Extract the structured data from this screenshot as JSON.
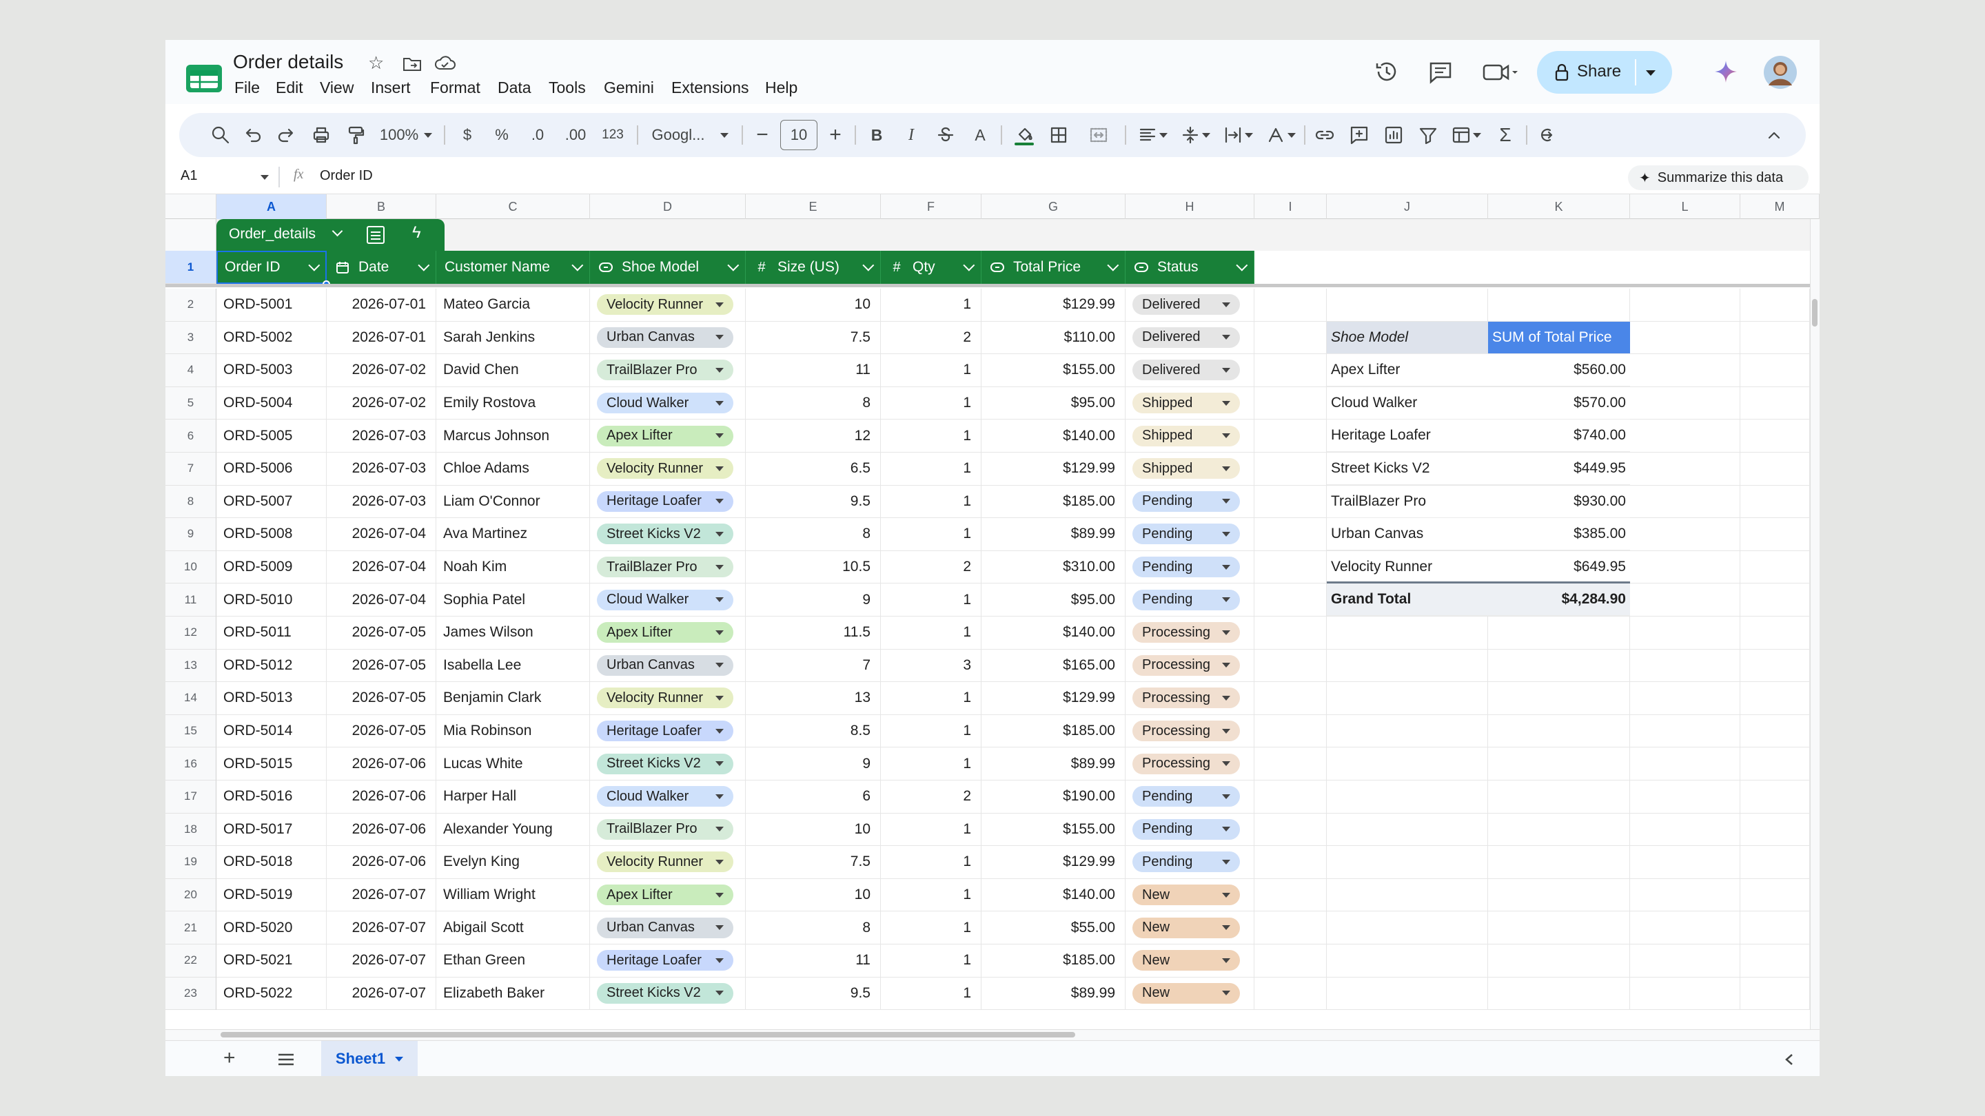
{
  "doc": {
    "title": "Order details"
  },
  "menu": [
    "File",
    "Edit",
    "View",
    "Insert",
    "Format",
    "Data",
    "Tools",
    "Gemini",
    "Extensions",
    "Help"
  ],
  "header": {
    "share_label": "Share"
  },
  "toolbar": {
    "zoom": "100%",
    "currency": "$",
    "percent": "%",
    "dec_less": ".0",
    "dec_more": ".00",
    "format_123": "123",
    "font": "Googl...",
    "font_size": "10",
    "bold": "B",
    "italic": "I",
    "text_color": "A"
  },
  "formula": {
    "cell_ref": "A1",
    "fx": "fx",
    "value": "Order ID",
    "summarize": "Summarize this data"
  },
  "columns": [
    "A",
    "B",
    "C",
    "D",
    "E",
    "F",
    "G",
    "H",
    "I",
    "J",
    "K",
    "L",
    "M"
  ],
  "table": {
    "name": "Order_details",
    "headers": [
      "Order ID",
      "Date",
      "Customer Name",
      "Shoe Model",
      "Size (US)",
      "Qty",
      "Total Price",
      "Status"
    ],
    "header_icons": {
      "date": "📅",
      "model": "⊙",
      "size": "#",
      "qty": "#",
      "price": "⊙",
      "status": "⊙"
    },
    "rows": [
      {
        "n": "2",
        "id": "ORD-5001",
        "date": "2026-07-01",
        "name": "Mateo Garcia",
        "model": "Velocity Runner",
        "size": "10",
        "qty": "1",
        "price": "$129.99",
        "status": "Delivered"
      },
      {
        "n": "3",
        "id": "ORD-5002",
        "date": "2026-07-01",
        "name": "Sarah Jenkins",
        "model": "Urban Canvas",
        "size": "7.5",
        "qty": "2",
        "price": "$110.00",
        "status": "Delivered"
      },
      {
        "n": "4",
        "id": "ORD-5003",
        "date": "2026-07-02",
        "name": "David Chen",
        "model": "TrailBlazer Pro",
        "size": "11",
        "qty": "1",
        "price": "$155.00",
        "status": "Delivered"
      },
      {
        "n": "5",
        "id": "ORD-5004",
        "date": "2026-07-02",
        "name": "Emily Rostova",
        "model": "Cloud Walker",
        "size": "8",
        "qty": "1",
        "price": "$95.00",
        "status": "Shipped"
      },
      {
        "n": "6",
        "id": "ORD-5005",
        "date": "2026-07-03",
        "name": "Marcus Johnson",
        "model": "Apex Lifter",
        "size": "12",
        "qty": "1",
        "price": "$140.00",
        "status": "Shipped"
      },
      {
        "n": "7",
        "id": "ORD-5006",
        "date": "2026-07-03",
        "name": "Chloe Adams",
        "model": "Velocity Runner",
        "size": "6.5",
        "qty": "1",
        "price": "$129.99",
        "status": "Shipped"
      },
      {
        "n": "8",
        "id": "ORD-5007",
        "date": "2026-07-03",
        "name": "Liam O'Connor",
        "model": "Heritage Loafer",
        "size": "9.5",
        "qty": "1",
        "price": "$185.00",
        "status": "Pending"
      },
      {
        "n": "9",
        "id": "ORD-5008",
        "date": "2026-07-04",
        "name": "Ava Martinez",
        "model": "Street Kicks V2",
        "size": "8",
        "qty": "1",
        "price": "$89.99",
        "status": "Pending"
      },
      {
        "n": "10",
        "id": "ORD-5009",
        "date": "2026-07-04",
        "name": "Noah Kim",
        "model": "TrailBlazer Pro",
        "size": "10.5",
        "qty": "2",
        "price": "$310.00",
        "status": "Pending"
      },
      {
        "n": "11",
        "id": "ORD-5010",
        "date": "2026-07-04",
        "name": "Sophia Patel",
        "model": "Cloud Walker",
        "size": "9",
        "qty": "1",
        "price": "$95.00",
        "status": "Pending"
      },
      {
        "n": "12",
        "id": "ORD-5011",
        "date": "2026-07-05",
        "name": "James Wilson",
        "model": "Apex Lifter",
        "size": "11.5",
        "qty": "1",
        "price": "$140.00",
        "status": "Processing"
      },
      {
        "n": "13",
        "id": "ORD-5012",
        "date": "2026-07-05",
        "name": "Isabella Lee",
        "model": "Urban Canvas",
        "size": "7",
        "qty": "3",
        "price": "$165.00",
        "status": "Processing"
      },
      {
        "n": "14",
        "id": "ORD-5013",
        "date": "2026-07-05",
        "name": "Benjamin Clark",
        "model": "Velocity Runner",
        "size": "13",
        "qty": "1",
        "price": "$129.99",
        "status": "Processing"
      },
      {
        "n": "15",
        "id": "ORD-5014",
        "date": "2026-07-05",
        "name": "Mia Robinson",
        "model": "Heritage Loafer",
        "size": "8.5",
        "qty": "1",
        "price": "$185.00",
        "status": "Processing"
      },
      {
        "n": "16",
        "id": "ORD-5015",
        "date": "2026-07-06",
        "name": "Lucas White",
        "model": "Street Kicks V2",
        "size": "9",
        "qty": "1",
        "price": "$89.99",
        "status": "Processing"
      },
      {
        "n": "17",
        "id": "ORD-5016",
        "date": "2026-07-06",
        "name": "Harper Hall",
        "model": "Cloud Walker",
        "size": "6",
        "qty": "2",
        "price": "$190.00",
        "status": "Pending"
      },
      {
        "n": "18",
        "id": "ORD-5017",
        "date": "2026-07-06",
        "name": "Alexander Young",
        "model": "TrailBlazer Pro",
        "size": "10",
        "qty": "1",
        "price": "$155.00",
        "status": "Pending"
      },
      {
        "n": "19",
        "id": "ORD-5018",
        "date": "2026-07-06",
        "name": "Evelyn King",
        "model": "Velocity Runner",
        "size": "7.5",
        "qty": "1",
        "price": "$129.99",
        "status": "Pending"
      },
      {
        "n": "20",
        "id": "ORD-5019",
        "date": "2026-07-07",
        "name": "William Wright",
        "model": "Apex Lifter",
        "size": "10",
        "qty": "1",
        "price": "$140.00",
        "status": "New"
      },
      {
        "n": "21",
        "id": "ORD-5020",
        "date": "2026-07-07",
        "name": "Abigail Scott",
        "model": "Urban Canvas",
        "size": "8",
        "qty": "1",
        "price": "$55.00",
        "status": "New"
      },
      {
        "n": "22",
        "id": "ORD-5021",
        "date": "2026-07-07",
        "name": "Ethan Green",
        "model": "Heritage Loafer",
        "size": "11",
        "qty": "1",
        "price": "$185.00",
        "status": "New"
      },
      {
        "n": "23",
        "id": "ORD-5022",
        "date": "2026-07-07",
        "name": "Elizabeth Baker",
        "model": "Street Kicks V2",
        "size": "9.5",
        "qty": "1",
        "price": "$89.99",
        "status": "New"
      }
    ]
  },
  "colors": {
    "models": {
      "Velocity Runner": "#e6eec3",
      "Urban Canvas": "#d7dde3",
      "TrailBlazer Pro": "#d6ebd9",
      "Cloud Walker": "#cfe1fb",
      "Apex Lifter": "#c9ecbc",
      "Heritage Loafer": "#c8d8fc",
      "Street Kicks V2": "#c2e6d9"
    },
    "status": {
      "Delivered": "#e5e5e5",
      "Shipped": "#f3ecd7",
      "Pending": "#cfe0f9",
      "Processing": "#f1dfd0",
      "New": "#f0d3b8"
    },
    "table_header": "#188038",
    "pivot_header": "#4a86e8"
  },
  "pivot": {
    "header_model": "Shoe Model",
    "header_sum": "SUM of Total Price",
    "rows": [
      {
        "model": "Apex Lifter",
        "sum": "$560.00"
      },
      {
        "model": "Cloud Walker",
        "sum": "$570.00"
      },
      {
        "model": "Heritage Loafer",
        "sum": "$740.00"
      },
      {
        "model": "Street Kicks V2",
        "sum": "$449.95"
      },
      {
        "model": "TrailBlazer Pro",
        "sum": "$930.00"
      },
      {
        "model": "Urban Canvas",
        "sum": "$385.00"
      },
      {
        "model": "Velocity Runner",
        "sum": "$649.95"
      }
    ],
    "total_label": "Grand Total",
    "total_value": "$4,284.90"
  },
  "sheets": {
    "active": "Sheet1"
  }
}
